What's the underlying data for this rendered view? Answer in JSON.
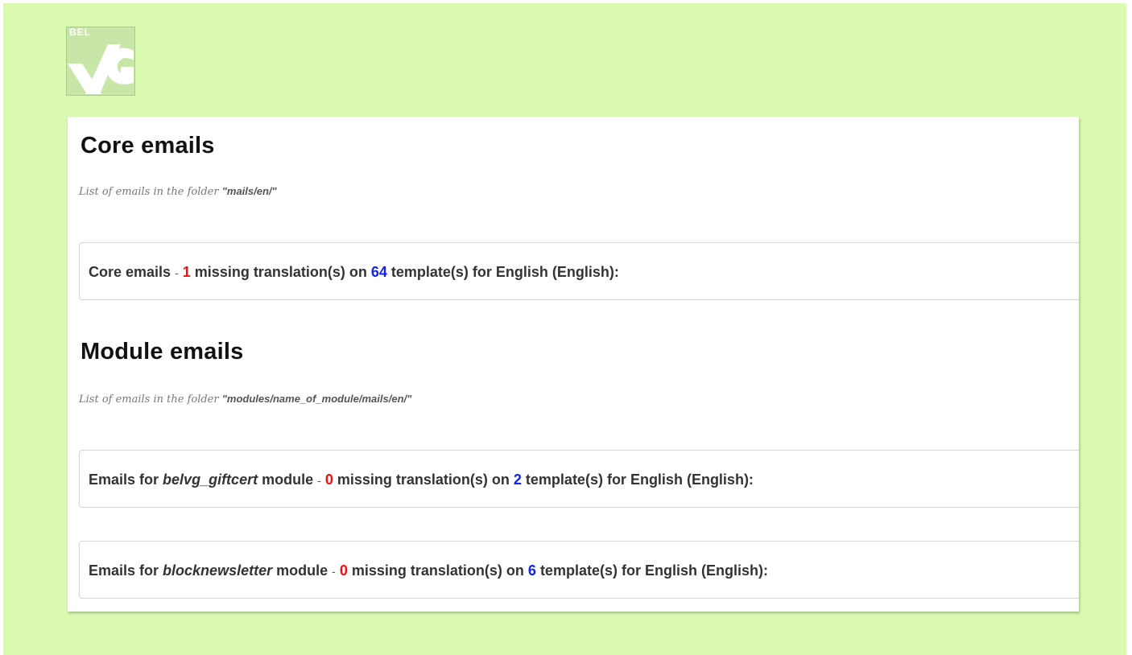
{
  "colors": {
    "background": "#d9fab0",
    "missing_count": "#ee1111",
    "template_count": "#1122ee"
  },
  "logo": {
    "text": "BEL",
    "icon": "belvg-logo-icon"
  },
  "core": {
    "title": "Core emails",
    "desc_prefix": "List of emails in the folder ",
    "desc_folder": "\"mails/en/\"",
    "rows": [
      {
        "label": "Core emails",
        "separator": "-",
        "missing": "1",
        "middle": "missing translation(s) on",
        "total": "64",
        "suffix": "template(s) for English (English):"
      }
    ]
  },
  "modules": {
    "title": "Module emails",
    "desc_prefix": "List of emails in the folder ",
    "desc_folder": "\"modules/name_of_module/mails/en/\"",
    "rows": [
      {
        "prefix": "Emails for",
        "module": "belvg_giftcert",
        "module_suffix": "module",
        "separator": "-",
        "missing": "0",
        "middle": "missing translation(s) on",
        "total": "2",
        "suffix": "template(s) for English (English):"
      },
      {
        "prefix": "Emails for",
        "module": "blocknewsletter",
        "module_suffix": "module",
        "separator": "-",
        "missing": "0",
        "middle": "missing translation(s) on",
        "total": "6",
        "suffix": "template(s) for English (English):"
      }
    ]
  }
}
